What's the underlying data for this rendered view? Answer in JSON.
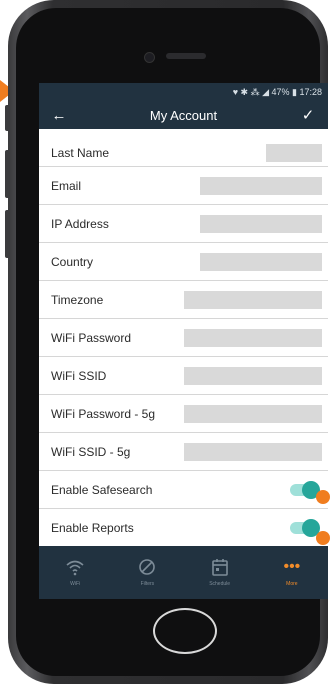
{
  "status": {
    "text": "♥ ✱ ⁂ ◢ 47% ▮ 17:28"
  },
  "appbar": {
    "title": "My Account",
    "back_icon": "←",
    "confirm_icon": "✓"
  },
  "settings": [
    {
      "label": "Last Name"
    },
    {
      "label": "Email"
    },
    {
      "label": "IP Address"
    },
    {
      "label": "Country"
    },
    {
      "label": "Timezone"
    },
    {
      "label": "WiFi Password"
    },
    {
      "label": "WiFi SSID"
    },
    {
      "label": "WiFi Password - 5g"
    },
    {
      "label": "WiFi SSID - 5g"
    },
    {
      "label": "Enable Safesearch",
      "toggle": "on"
    },
    {
      "label": "Enable Reports",
      "toggle": "on"
    }
  ],
  "tabs": [
    {
      "label": "WiFi",
      "icon": "wifi-icon"
    },
    {
      "label": "Filters",
      "icon": "block-icon"
    },
    {
      "label": "Schedule",
      "icon": "calendar-icon"
    },
    {
      "label": "More",
      "icon": "more-icon"
    }
  ],
  "colors": {
    "header": "#213240",
    "accent": "#26a69a",
    "callout": "#f07d1f",
    "active_tab": "#f28c2a"
  }
}
